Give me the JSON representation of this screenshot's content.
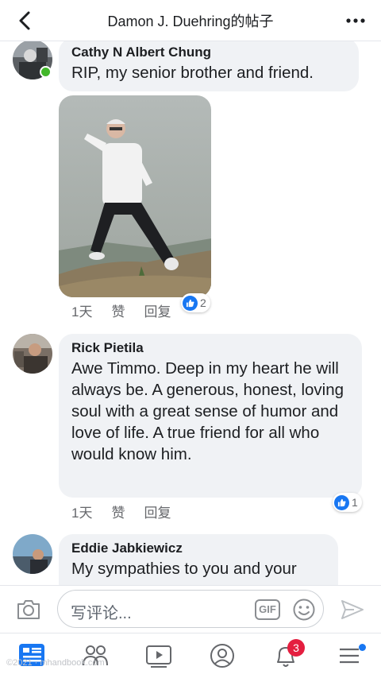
{
  "header": {
    "title": "Damon J. Duehring的帖子"
  },
  "comments": [
    {
      "author": "Cathy N Albert Chung",
      "text": "RIP, my senior brother and friend.",
      "time": "1天",
      "like_label": "赞",
      "reply_label": "回复",
      "reaction_count": "2",
      "online": true
    },
    {
      "author": "Rick Pietila",
      "text": "Awe Timmo.  Deep in my heart he will always be. A generous, honest, loving soul with a great sense of humor and love of life. A true friend for all who would know him.",
      "time": "1天",
      "like_label": "赞",
      "reply_label": "回复",
      "reaction_count": "1"
    },
    {
      "author": "Eddie Jabkiewicz",
      "text": "My sympathies to you and your"
    }
  ],
  "composer": {
    "placeholder": "写评论...",
    "gif_label": "GIF"
  },
  "tabbar": {
    "notifications_badge": "3"
  },
  "watermark": "©2021 · mhandbook.com",
  "colors": {
    "accent": "#1877f2",
    "badge": "#e41e3f",
    "online": "#42b72a",
    "bubble": "#f0f2f5"
  }
}
